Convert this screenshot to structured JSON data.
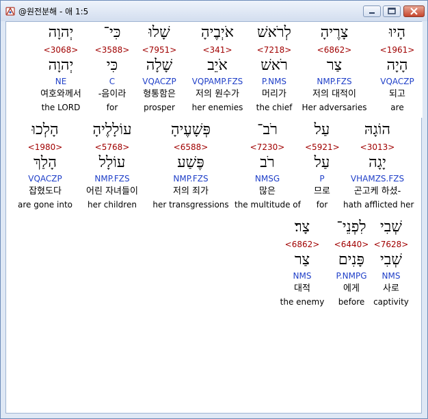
{
  "window": {
    "title": "@원전분해 - 애 1:5",
    "icon": "bible-app-icon",
    "controls": [
      "minimize",
      "maximize",
      "close"
    ]
  },
  "rows": [
    {
      "words": [
        {
          "hebrew": "הָיוּ",
          "strong": "<1961>",
          "lemma": "הָיָה",
          "morph": "VQACZP",
          "korean": "되고",
          "english": "are",
          "highlighted": true
        },
        {
          "hebrew": "צָרֶיהָ",
          "strong": "<6862>",
          "lemma": "צַר",
          "morph": "NMP.FZS",
          "korean": "저의 대적이",
          "english": "Her adversaries"
        },
        {
          "hebrew": "לְרֹאשׁ",
          "strong": "<7218>",
          "lemma": "רֹאשׁ",
          "morph": "P.NMS",
          "korean": "머리가",
          "english": "the chief"
        },
        {
          "hebrew": "אֹיְבֶיהָ",
          "strong": "<341>",
          "lemma": "אֹיֵב",
          "morph": "VQPAMP.FZS",
          "korean": "저의 원수가",
          "english": "her enemies"
        },
        {
          "hebrew": "שָׁלוּ",
          "strong": "<7951>",
          "lemma": "שָׁלָה",
          "morph": "VQACZP",
          "korean": "형통함은",
          "english": "prosper"
        },
        {
          "hebrew": "כִּי־",
          "strong": "<3588>",
          "lemma": "כִּי",
          "morph": "C",
          "korean": "-음이라",
          "english": "for"
        },
        {
          "hebrew": "יְהוָה",
          "strong": "<3068>",
          "lemma": "יְהוָה",
          "morph": "NE",
          "korean": "여호와께서",
          "english": "the LORD"
        }
      ]
    },
    {
      "words": [
        {
          "hebrew": "הוֹגָהּ",
          "strong": "<3013>",
          "lemma": "יָגָה",
          "morph": "VHAMZS.FZS",
          "korean": "곤고케 하셨-",
          "english": "hath afflicted her"
        },
        {
          "hebrew": "עַל",
          "strong": "<5921>",
          "lemma": "עַל",
          "morph": "P",
          "korean": "므로",
          "english": "for"
        },
        {
          "hebrew": "רֹב־",
          "strong": "<7230>",
          "lemma": "רֹב",
          "morph": "NMSG",
          "korean": "많은",
          "english": "the multitude of"
        },
        {
          "hebrew": "פְּשָׁעֶיהָ",
          "strong": "<6588>",
          "lemma": "פֶּשַׁע",
          "morph": "NMP.FZS",
          "korean": "저의 죄가",
          "english": "her transgressions"
        },
        {
          "hebrew": "עוֹלָלֶיהָ",
          "strong": "<5768>",
          "lemma": "עוֹלָל",
          "morph": "NMP.FZS",
          "korean": "어린 자녀들이",
          "english": "her children"
        },
        {
          "hebrew": "הָלְכוּ",
          "strong": "<1980>",
          "lemma": "הָלַךְ",
          "morph": "VQACZP",
          "korean": "잡혔도다",
          "english": "are gone into"
        }
      ]
    },
    {
      "words": [
        {
          "hebrew": "שְׁבִי",
          "strong": "<7628>",
          "lemma": "שְׁבִי",
          "morph": "NMS",
          "korean": "사로",
          "english": "captivity"
        },
        {
          "hebrew": "לִפְנֵי־",
          "strong": "<6440>",
          "lemma": "פָּנִים",
          "morph": "P.NMPG",
          "korean": "에게",
          "english": "before"
        },
        {
          "hebrew": "צָר׃",
          "strong": "<6862>",
          "lemma": "צַר",
          "morph": "NMS",
          "korean": "대적",
          "english": "the enemy"
        }
      ]
    }
  ]
}
